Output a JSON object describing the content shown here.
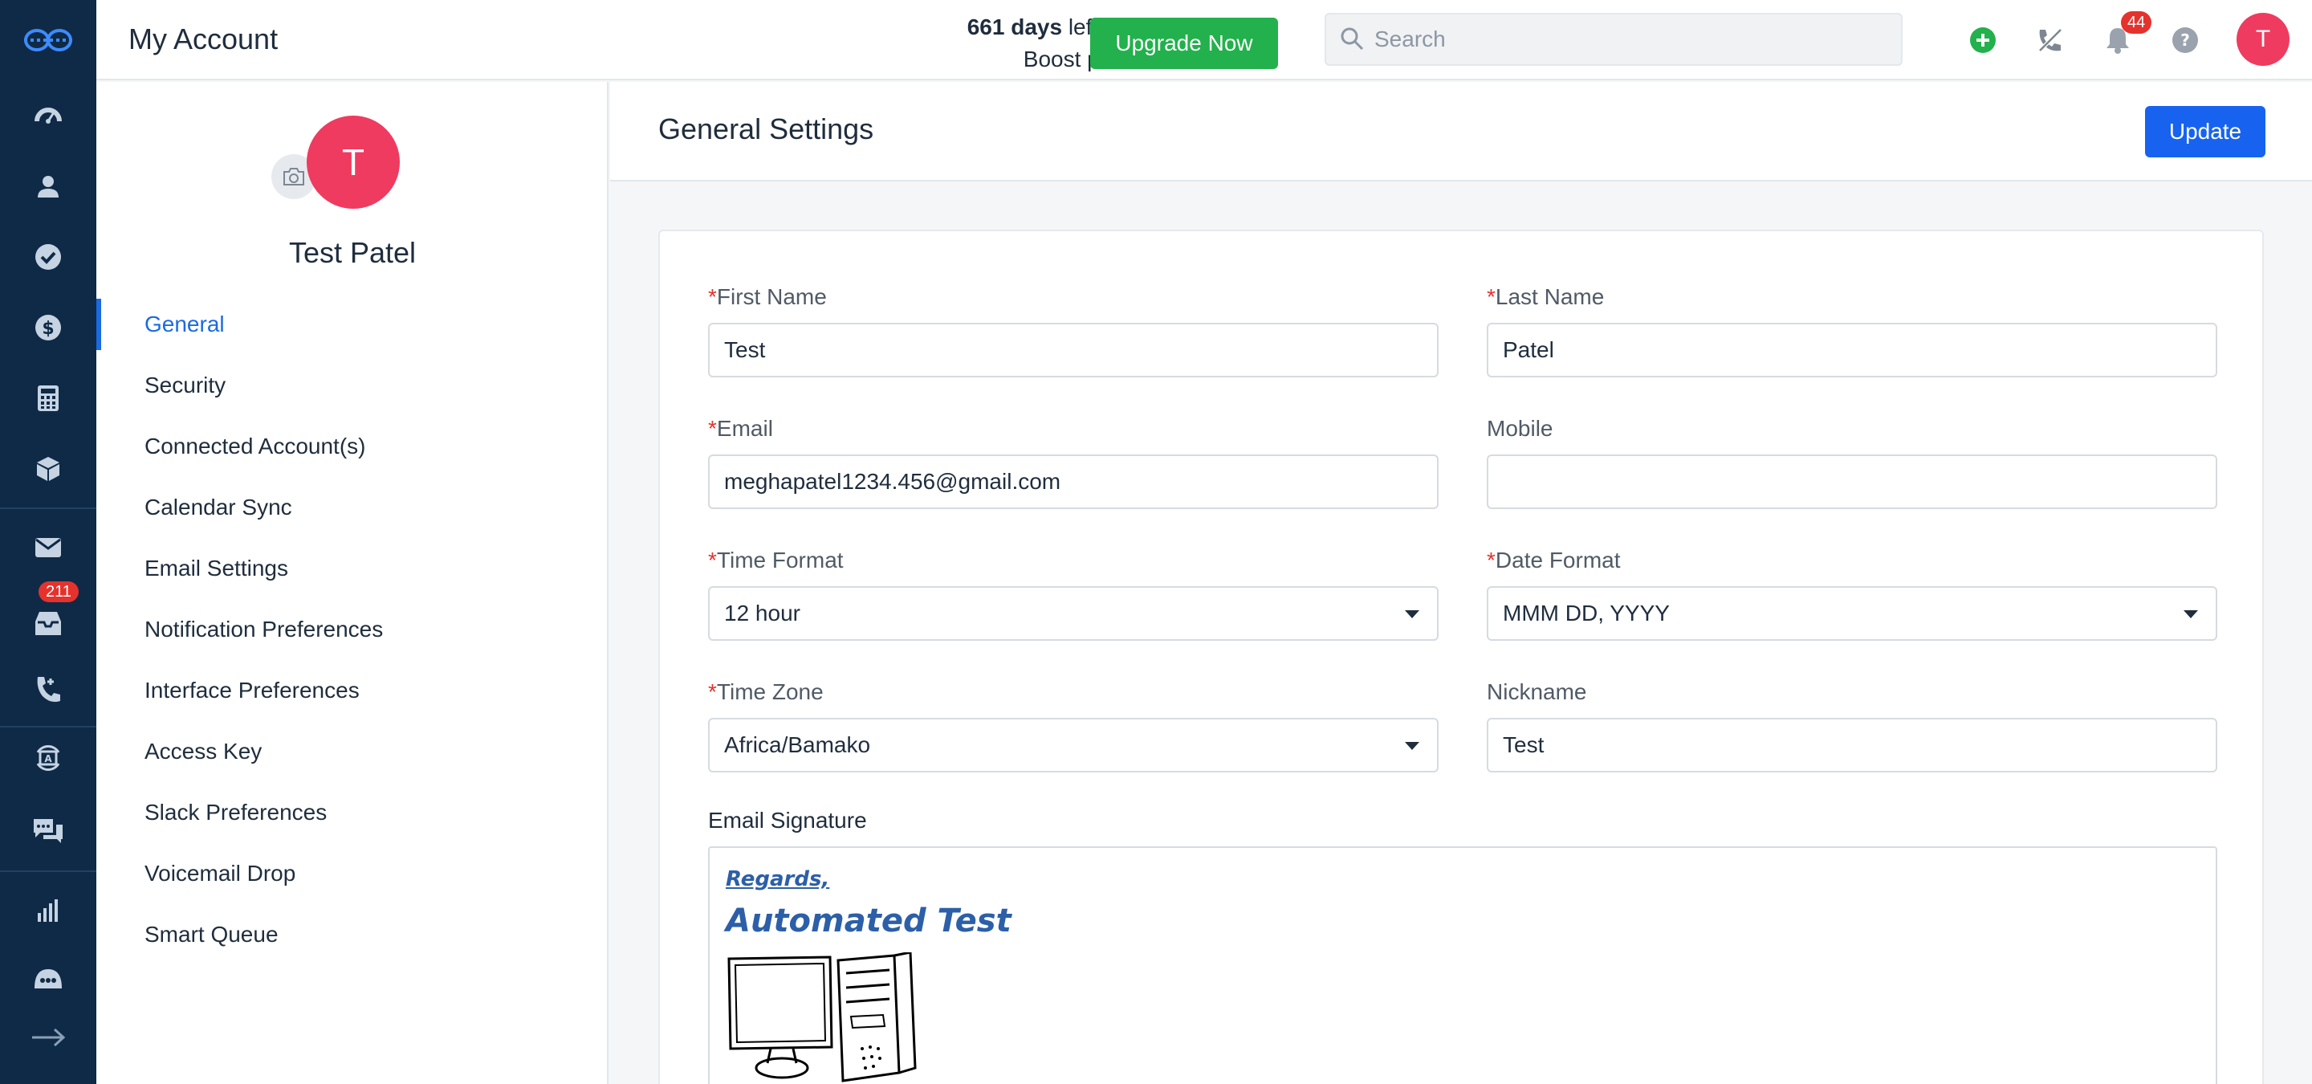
{
  "header": {
    "title": "My Account",
    "trial_days": "661 days",
    "trial_text_1": " left in your",
    "trial_text_2": "Boost plan trial",
    "upgrade_label": "Upgrade Now",
    "search_placeholder": "Search",
    "notification_count": "44",
    "user_initial": "T"
  },
  "rail": {
    "inbox_badge": "211",
    "icons": [
      "logo-icon",
      "dashboard-icon",
      "contacts-icon",
      "tasks-icon",
      "deals-icon",
      "calculator-icon",
      "products-icon",
      "email-icon",
      "inbox-icon",
      "phone-icon",
      "automation-icon",
      "chat-icon",
      "reports-icon",
      "bot-icon",
      "expand-icon"
    ]
  },
  "profile": {
    "initial": "T",
    "name": "Test Patel"
  },
  "nav": {
    "items": [
      {
        "label": "General",
        "active": true
      },
      {
        "label": "Security"
      },
      {
        "label": "Connected Account(s)"
      },
      {
        "label": "Calendar Sync"
      },
      {
        "label": "Email Settings"
      },
      {
        "label": "Notification Preferences"
      },
      {
        "label": "Interface Preferences"
      },
      {
        "label": "Access Key"
      },
      {
        "label": "Slack Preferences"
      },
      {
        "label": "Voicemail Drop"
      },
      {
        "label": "Smart Queue"
      }
    ]
  },
  "main": {
    "title": "General Settings",
    "update_label": "Update"
  },
  "form": {
    "first_name": {
      "label": "First Name",
      "required_mark": "*",
      "value": "Test"
    },
    "last_name": {
      "label": "Last Name",
      "required_mark": "*",
      "value": "Patel"
    },
    "email": {
      "label": "Email",
      "required_mark": "*",
      "value": "meghapatel1234.456@gmail.com"
    },
    "mobile": {
      "label": "Mobile",
      "value": ""
    },
    "time_format": {
      "label": "Time Format",
      "required_mark": "*",
      "value": "12 hour"
    },
    "date_format": {
      "label": "Date Format",
      "required_mark": "*",
      "value": "MMM DD, YYYY"
    },
    "time_zone": {
      "label": "Time Zone",
      "required_mark": "*",
      "value": "Africa/Bamako"
    },
    "nickname": {
      "label": "Nickname",
      "value": "Test"
    },
    "signature": {
      "label": "Email Signature",
      "regards": "Regards,",
      "name": "Automated Test"
    }
  },
  "colors": {
    "rail_bg": "#0f2a46",
    "accent_blue": "#1763f0",
    "upgrade_green": "#22b14c",
    "avatar_pink": "#ef3b5f",
    "badge_red": "#e5322d"
  }
}
